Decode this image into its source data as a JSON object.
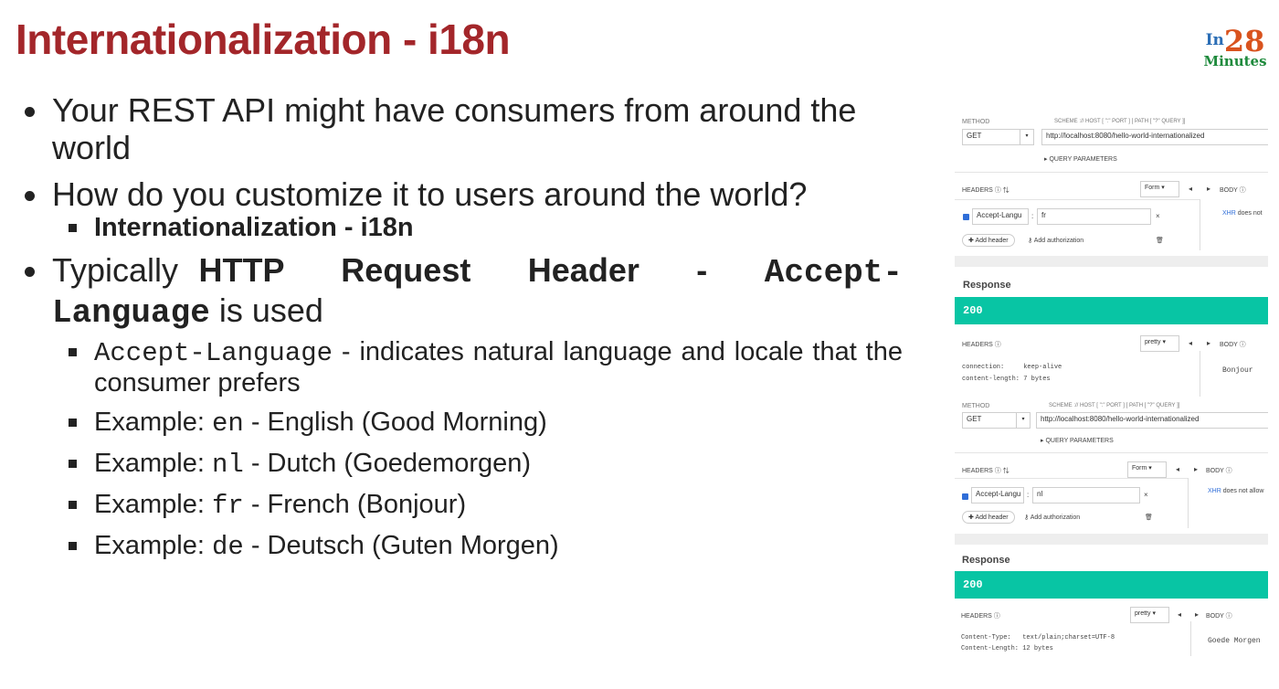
{
  "slide": {
    "title": "Internationalization - i18n",
    "logo": {
      "in": "In",
      "num": "28",
      "minutes": "Minutes"
    }
  },
  "bullets": {
    "b1": "Your REST API might have consumers from around the world",
    "b2": "How do you customize it to users around the world?",
    "b2_sub": "Internationalization - i18n",
    "b3_pre": "Typically ",
    "b3_http": "HTTP Request Header - ",
    "b3_code": "Accept-Language",
    "b3_post": " is used",
    "sub_accept_code": "Accept-Language",
    "sub_accept_text": " - indicates natural language and locale that the consumer prefers",
    "examples": [
      {
        "pre": "Example: ",
        "code": "en",
        "post": " - English (Good Morning)"
      },
      {
        "pre": "Example: ",
        "code": "nl",
        "post": " - Dutch (Goedemorgen)"
      },
      {
        "pre": "Example: ",
        "code": "fr",
        "post": " - French (Bonjour)"
      },
      {
        "pre": "Example: ",
        "code": "de",
        "post": " - Deutsch (Guten Morgen)"
      }
    ]
  },
  "screenshot": {
    "method_label": "METHOD",
    "scheme_label": "SCHEME :// HOST [ \":\" PORT ] [ PATH [ \"?\" QUERY ]]",
    "method_value": "GET",
    "url": "http://localhost:8080/hello-world-internationalized",
    "query_params": "QUERY PARAMETERS",
    "headers_label": "HEADERS",
    "form_label": "Form",
    "body_label": "BODY",
    "header_name": "Accept-Langu",
    "header_value_1": "fr",
    "header_value_2": "nl",
    "add_header": "Add header",
    "add_auth": "Add authorization",
    "xhr_text_1": "does not",
    "xhr_text_2": "does not allow",
    "xhr": "XHR",
    "response_label": "Response",
    "status": "200",
    "pretty_label": "pretty",
    "resp1_h1_k": "connection:",
    "resp1_h1_v": "keep-alive",
    "resp1_h2_k": "content-length:",
    "resp1_h2_v": "7 bytes",
    "resp1_body": "Bonjour",
    "resp2_h1_k": "Content-Type:",
    "resp2_h1_v": "text/plain;charset=UTF-8",
    "resp2_h2_k": "Content-Length:",
    "resp2_h2_v": "12 bytes",
    "resp2_body": "Goede Morgen"
  }
}
